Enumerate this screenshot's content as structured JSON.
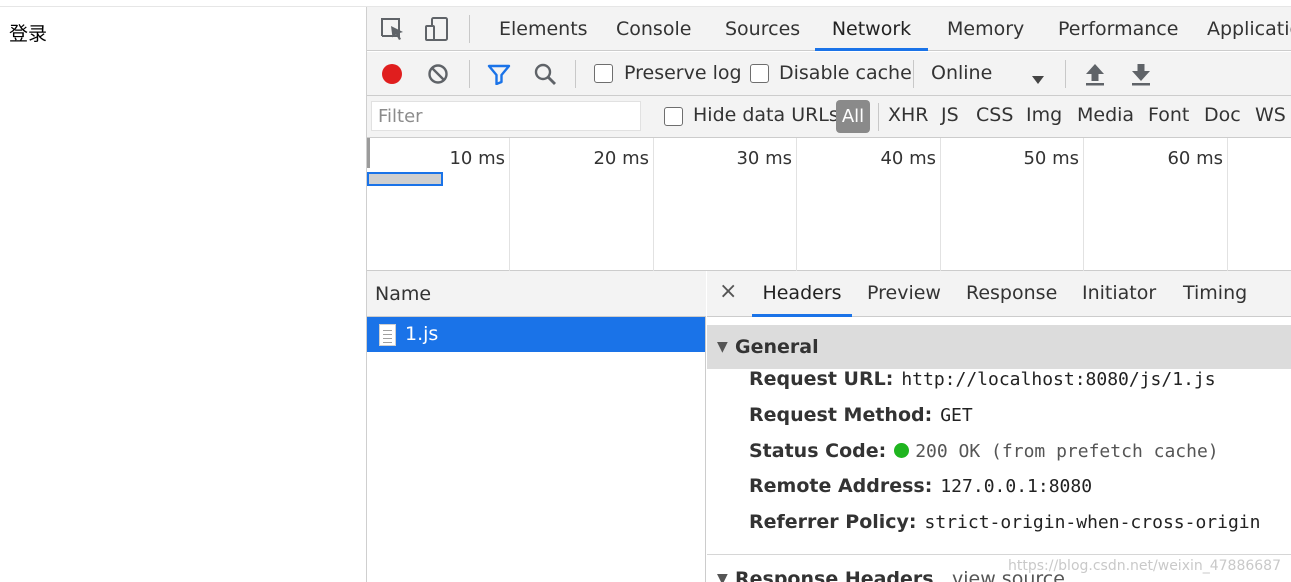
{
  "page": {
    "link_text": "登录"
  },
  "devtools": {
    "tabs": [
      "Elements",
      "Console",
      "Sources",
      "Network",
      "Memory",
      "Performance",
      "Applicatio"
    ],
    "active_tab": "Network",
    "toolbar": {
      "preserve_log": "Preserve log",
      "disable_cache": "Disable cache",
      "throttle": "Online",
      "colors": {
        "record": "#e01e1e",
        "filter_icon": "#1a73e8"
      }
    },
    "filterbar": {
      "filter_placeholder": "Filter",
      "hide_data_urls": "Hide data URLs",
      "types": [
        "All",
        "XHR",
        "JS",
        "CSS",
        "Img",
        "Media",
        "Font",
        "Doc",
        "WS"
      ],
      "active_type": "All"
    },
    "overview": {
      "ticks": [
        "10 ms",
        "20 ms",
        "30 ms",
        "40 ms",
        "50 ms",
        "60 ms"
      ]
    },
    "requests": {
      "column_name": "Name",
      "rows": [
        {
          "name": "1.js",
          "selected": true
        }
      ]
    },
    "detail": {
      "close": "×",
      "tabs": [
        "Headers",
        "Preview",
        "Response",
        "Initiator",
        "Timing"
      ],
      "active_tab": "Headers",
      "general_title": "General",
      "general": [
        {
          "key": "Request URL:",
          "value": "http://localhost:8080/js/1.js"
        },
        {
          "key": "Request Method:",
          "value": "GET"
        },
        {
          "key": "Status Code:",
          "value": "200 OK (from prefetch cache)",
          "status_color": "#1fb51f"
        },
        {
          "key": "Remote Address:",
          "value": "127.0.0.1:8080"
        },
        {
          "key": "Referrer Policy:",
          "value": "strict-origin-when-cross-origin"
        }
      ],
      "response_headers_title": "Response Headers",
      "view_source": "view source"
    },
    "watermark": "https://blog.csdn.net/weixin_47886687"
  }
}
